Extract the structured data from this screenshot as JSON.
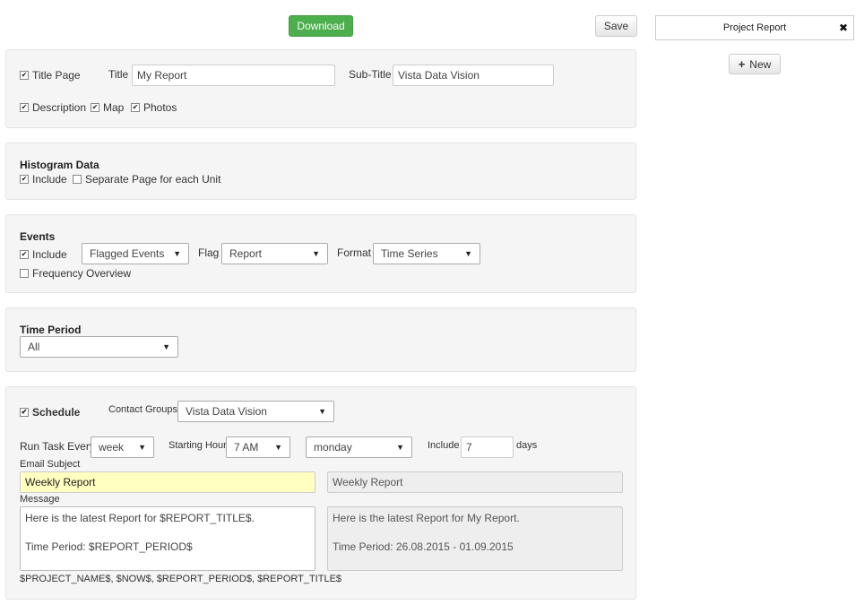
{
  "toolbar": {
    "download_label": "Download",
    "save_label": "Save"
  },
  "sidebar": {
    "project_label": "Project Report",
    "new_label": "New"
  },
  "title_panel": {
    "title_page_label": "Title Page",
    "title_page_checked": true,
    "title_label": "Title",
    "title_value": "My Report",
    "subtitle_label": "Sub-Title",
    "subtitle_value": "Vista Data Vision",
    "description_label": "Description",
    "map_label": "Map",
    "photos_label": "Photos"
  },
  "histogram": {
    "heading": "Histogram Data",
    "include_label": "Include",
    "separate_label": "Separate Page for each Unit"
  },
  "events": {
    "heading": "Events",
    "include_label": "Include",
    "type_value": "Flagged Events",
    "flag_label": "Flag",
    "flag_value": "Report",
    "format_label": "Format",
    "format_value": "Time Series",
    "frequency_label": "Frequency Overview"
  },
  "time_period": {
    "heading": "Time Period",
    "value": "All"
  },
  "schedule": {
    "label": "Schedule",
    "contact_groups_label": "Contact Groups",
    "contact_groups_value": "Vista Data Vision",
    "run_task_label": "Run Task Every",
    "run_task_value": "week",
    "starting_hour_label": "Starting Hour",
    "starting_hour_value": "7 AM",
    "day_value": "monday",
    "include_label": "Include",
    "include_value": "7",
    "days_label": "days",
    "email_subject_label": "Email Subject",
    "email_subject_value": "Weekly Report",
    "email_subject_preview": "Weekly Report",
    "message_label": "Message",
    "message_value": "Here is the latest Report for $REPORT_TITLE$.\n\nTime Period: $REPORT_PERIOD$",
    "message_preview": "Here is the latest Report for My Report.\n\nTime Period: 26.08.2015 - 01.09.2015",
    "variables_hint": "$PROJECT_NAME$, $NOW$, $REPORT_PERIOD$, $REPORT_TITLE$"
  },
  "icons": {
    "check": "✔",
    "close": "✖",
    "plus": "+",
    "caret": "▼"
  }
}
